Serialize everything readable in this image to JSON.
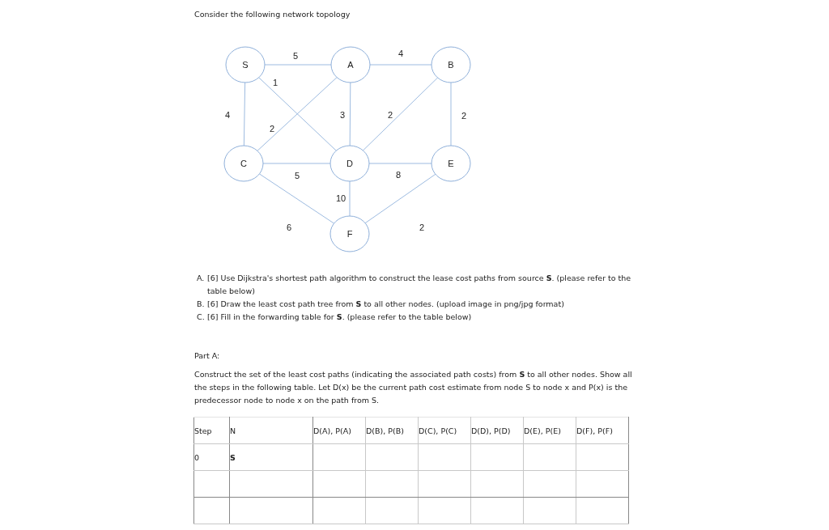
{
  "title": "Consider the following network topology",
  "diagram": {
    "nodes": [
      {
        "label": "S"
      },
      {
        "label": "A"
      },
      {
        "label": "B"
      },
      {
        "label": "C"
      },
      {
        "label": "D"
      },
      {
        "label": "E"
      },
      {
        "label": "F"
      }
    ],
    "edges": [
      {
        "weight": "5"
      },
      {
        "weight": "4"
      },
      {
        "weight": "1"
      },
      {
        "weight": "4"
      },
      {
        "weight": "2"
      },
      {
        "weight": "3"
      },
      {
        "weight": "2"
      },
      {
        "weight": "2"
      },
      {
        "weight": "5"
      },
      {
        "weight": "8"
      },
      {
        "weight": "10"
      },
      {
        "weight": "6"
      },
      {
        "weight": "2"
      }
    ]
  },
  "questions": [
    {
      "marker": "A.",
      "text": "[6] Use Dijkstra's shortest path algorithm to construct the lease cost paths from source **S**. (please refer to the table below)"
    },
    {
      "marker": "B.",
      "text": "[6] Draw the least cost path tree from **S** to all other nodes. (upload image in png/jpg format)"
    },
    {
      "marker": "C.",
      "text": "[6] Fill in the forwarding table for **S**.  (please refer to the table below)"
    }
  ],
  "part_heading": "Part A:",
  "part_text": "Construct the set of the least cost paths (indicating the associated path costs) from **S** to all other nodes. Show all the steps in the following table. Let D(x) be the current path cost estimate from node S to node x and P(x) is the predecessor node to node x on the path from S.",
  "table": {
    "columns": [
      "Step",
      "N",
      "D(A), P(A)",
      "D(B), P(B)",
      "D(C), P(C)",
      "D(D), P(D)",
      "D(E), P(E)",
      "D(F), P(F)"
    ],
    "rows": [
      {
        "step": "0",
        "n": "S"
      }
    ]
  }
}
